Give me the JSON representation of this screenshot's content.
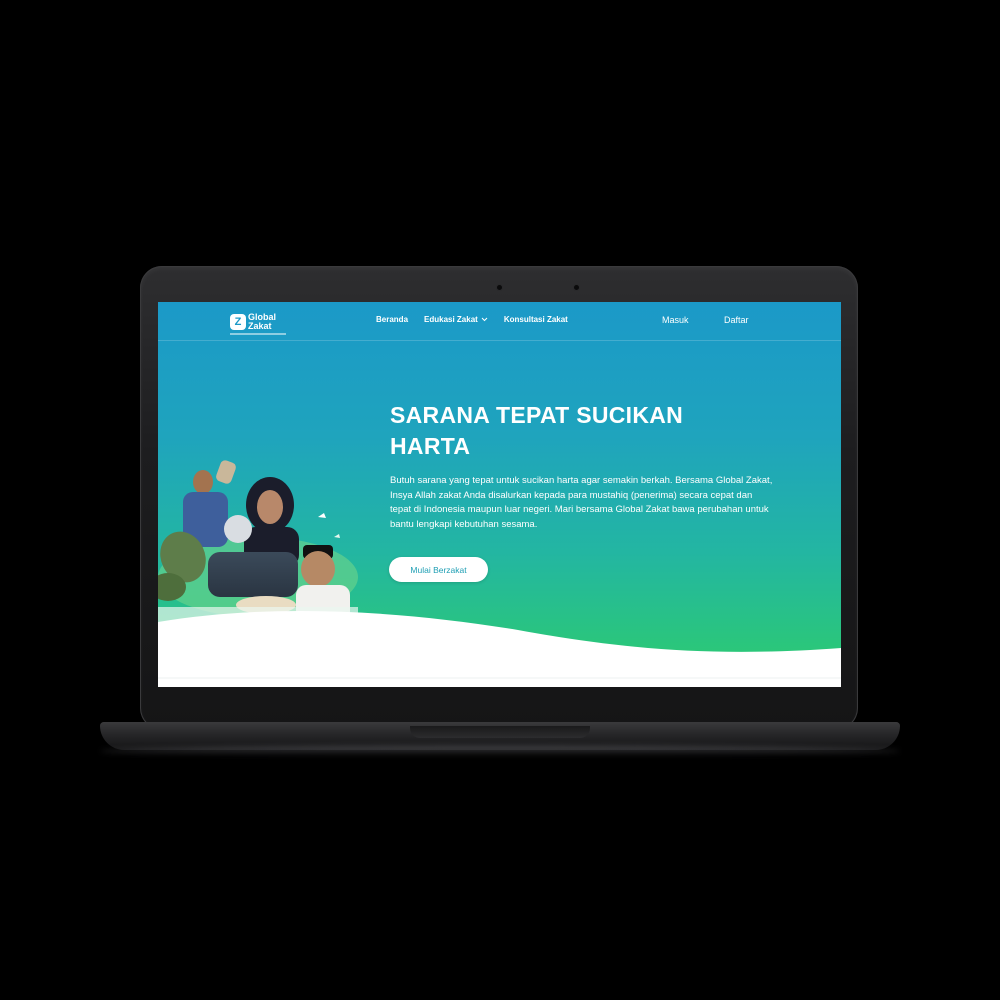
{
  "colors": {
    "hero_top": "#1b99c8",
    "hero_bottom": "#2fcd6e",
    "button_text": "#1f9fb4",
    "laptop": "#1d1d1f"
  },
  "nav": {
    "logo_line1": "Global",
    "logo_line2": "Zakat",
    "logo_icon": "global-zakat-logo-icon",
    "links": [
      {
        "label": "Beranda"
      },
      {
        "label": "Edukasi Zakat",
        "icon": "chevron-down-icon"
      },
      {
        "label": "Konsultasi Zakat"
      }
    ],
    "login": "Masuk",
    "register": "Daftar"
  },
  "hero": {
    "title": "SARANA TEPAT SUCIKAN HARTA",
    "description": "Butuh sarana yang tepat untuk sucikan harta agar semakin berkah. Bersama Global Zakat, Insya Allah zakat Anda disalurkan kepada para mustahiq (penerima) secara cepat dan tepat di Indonesia maupun luar negeri. Mari bersama Global Zakat bawa perubahan untuk bantu lengkapi kebutuhan sesama.",
    "cta": "Mulai Berzakat"
  }
}
